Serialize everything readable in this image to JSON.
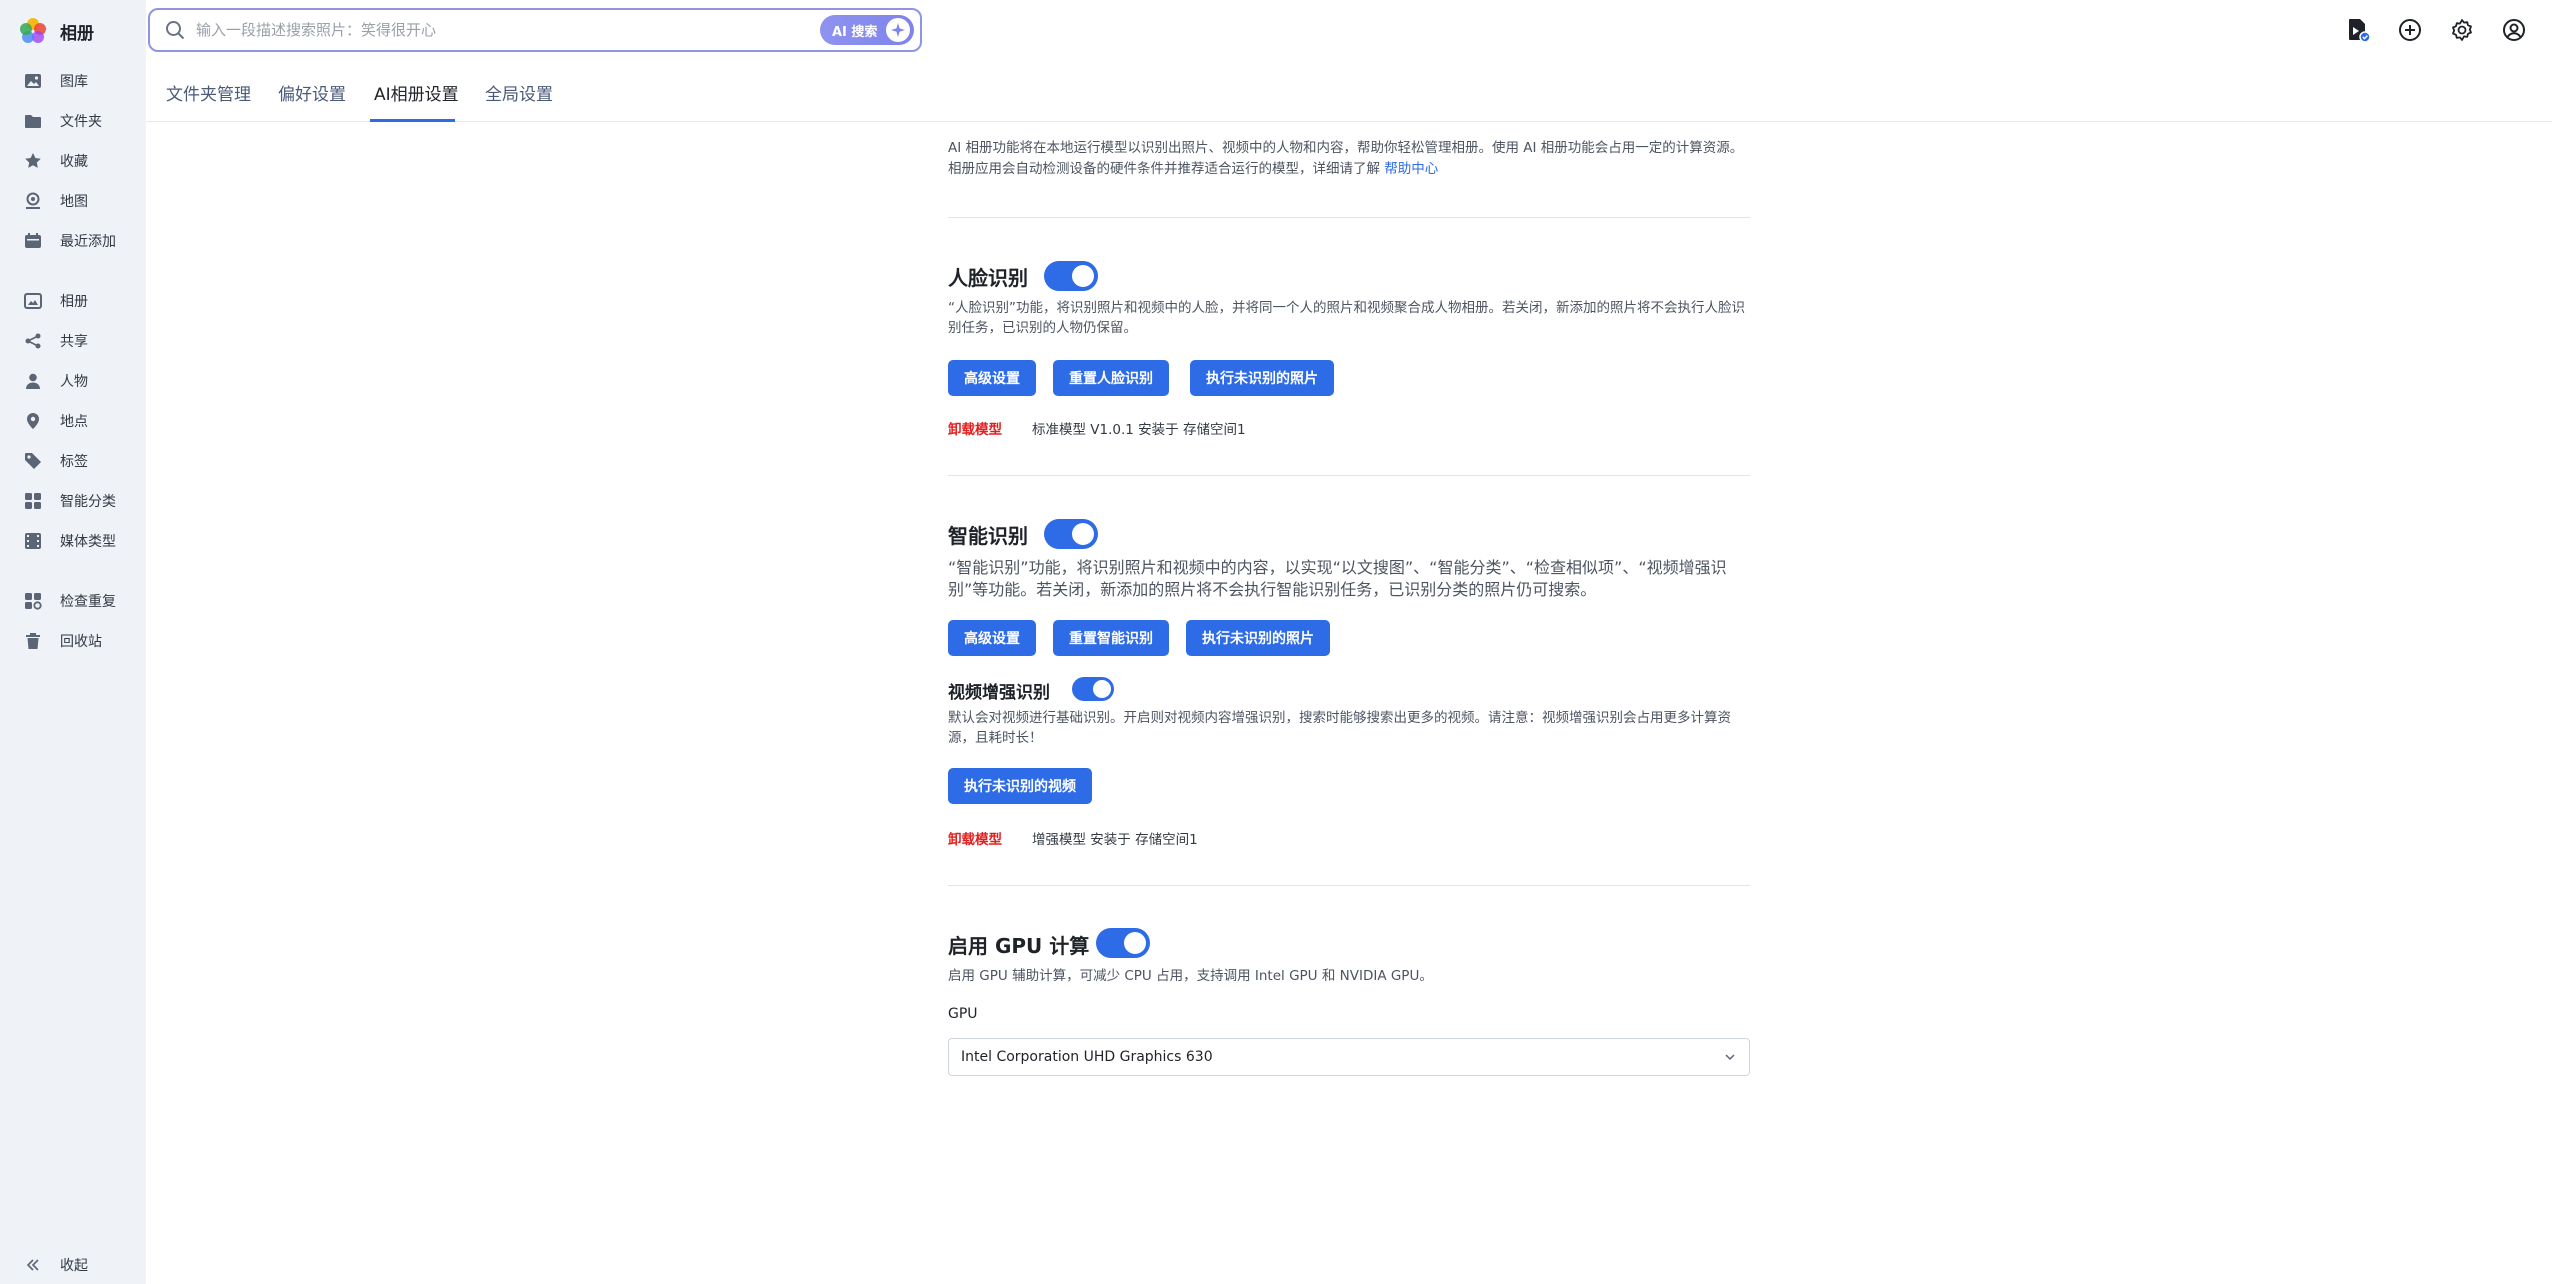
{
  "app": {
    "title": "相册"
  },
  "search": {
    "placeholder": "输入一段描述搜索照片：笑得很开心",
    "ai_label": "AI 搜索"
  },
  "sidebar": {
    "items": [
      {
        "label": "图库",
        "icon": "image-icon"
      },
      {
        "label": "文件夹",
        "icon": "folder-icon"
      },
      {
        "label": "收藏",
        "icon": "star-icon"
      },
      {
        "label": "地图",
        "icon": "map-icon"
      },
      {
        "label": "最近添加",
        "icon": "calendar-icon"
      },
      {
        "label": "相册",
        "icon": "album-icon"
      },
      {
        "label": "共享",
        "icon": "share-icon"
      },
      {
        "label": "人物",
        "icon": "person-icon"
      },
      {
        "label": "地点",
        "icon": "location-icon"
      },
      {
        "label": "标签",
        "icon": "tag-icon"
      },
      {
        "label": "智能分类",
        "icon": "grid-icon"
      },
      {
        "label": "媒体类型",
        "icon": "media-type-icon"
      },
      {
        "label": "检查重复",
        "icon": "duplicate-icon"
      },
      {
        "label": "回收站",
        "icon": "trash-icon"
      }
    ],
    "collapse_label": "收起"
  },
  "tabs": [
    {
      "label": "文件夹管理"
    },
    {
      "label": "偏好设置"
    },
    {
      "label": "AI相册设置",
      "active": true
    },
    {
      "label": "全局设置"
    }
  ],
  "intro": {
    "text": "AI 相册功能将在本地运行模型以识别出照片、视频中的人物和内容，帮助你轻松管理相册。使用 AI 相册功能会占用一定的计算资源。相册应用会自动检测设备的硬件条件并推荐适合运行的模型，详细请了解 ",
    "link": "帮助中心"
  },
  "face": {
    "title": "人脸识别",
    "enabled": true,
    "desc": "“人脸识别”功能，将识别照片和视频中的人脸，并将同一个人的照片和视频聚合成人物相册。若关闭，新添加的照片将不会执行人脸识别任务，已识别的人物仍保留。",
    "buttons": [
      "高级设置",
      "重置人脸识别",
      "执行未识别的照片"
    ],
    "uninstall_label": "卸载模型",
    "model_info": "标准模型 V1.0.1 安装于 存储空间1"
  },
  "smart": {
    "title": "智能识别",
    "enabled": true,
    "desc": "“智能识别”功能，将识别照片和视频中的内容，以实现“以文搜图”、“智能分类”、“检查相似项”、“视频增强识别”等功能。若关闭，新添加的照片将不会执行智能识别任务，已识别分类的照片仍可搜索。",
    "buttons": [
      "高级设置",
      "重置智能识别",
      "执行未识别的照片"
    ],
    "video": {
      "title": "视频增强识别",
      "enabled": true,
      "desc": "默认会对视频进行基础识别。开启则对视频内容增强识别，搜索时能够搜索出更多的视频。请注意：视频增强识别会占用更多计算资源，且耗时长！",
      "button": "执行未识别的视频"
    },
    "uninstall_label": "卸载模型",
    "model_info": "增强模型 安装于 存储空间1"
  },
  "gpu": {
    "title": "启用 GPU 计算",
    "enabled": true,
    "desc": "启用 GPU 辅助计算，可减少 CPU 占用，支持调用 Intel GPU 和 NVIDIA GPU。",
    "field_label": "GPU",
    "selected": "Intel Corporation UHD Graphics 630"
  },
  "colors": {
    "accent": "#2e6be6",
    "danger": "#e02020",
    "sidebar_bg": "#eff2f7",
    "search_border": "#8f95e6"
  }
}
